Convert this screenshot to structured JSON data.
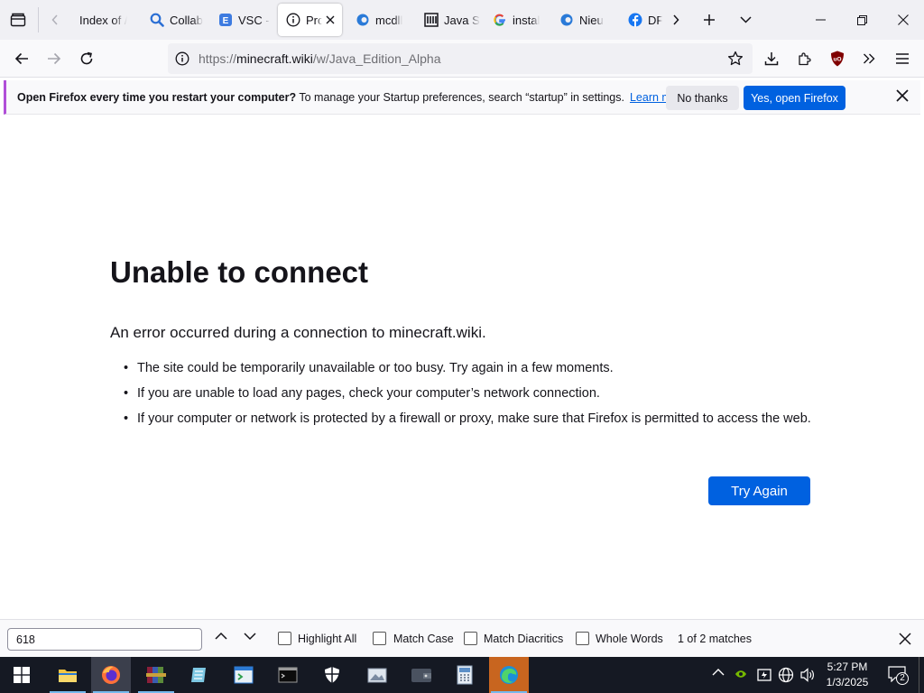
{
  "tabs": [
    {
      "title": "Index of /",
      "icon": "none"
    },
    {
      "title": "Collab",
      "icon": "magnifier-icon"
    },
    {
      "title": "VSC -",
      "icon": "e-icon"
    },
    {
      "title": "Pro",
      "icon": "info-icon",
      "active": true
    },
    {
      "title": "mcdll",
      "icon": "edge-icon"
    },
    {
      "title": "Java S",
      "icon": "library-icon"
    },
    {
      "title": "instal",
      "icon": "google-icon"
    },
    {
      "title": "Nieu",
      "icon": "edge-icon"
    },
    {
      "title": "DF",
      "icon": "facebook-icon"
    }
  ],
  "url": {
    "prefix": "https://",
    "host": "minecraft.wiki",
    "path": "/w/Java_Edition_Alpha"
  },
  "notification": {
    "bold": "Open Firefox every time you restart your computer?",
    "text": "To manage your Startup preferences, search “startup” in settings.",
    "link": "Learn more",
    "no_thanks": "No thanks",
    "yes": "Yes, open Firefox"
  },
  "error": {
    "title": "Unable to connect",
    "description": "An error occurred during a connection to minecraft.wiki.",
    "bullets": [
      "The site could be temporarily unavailable or too busy. Try again in a few moments.",
      "If you are unable to load any pages, check your computer’s network connection.",
      "If your computer or network is protected by a firewall or proxy, make sure that Firefox is permitted to access the web."
    ],
    "try_again": "Try Again"
  },
  "findbar": {
    "query": "618",
    "highlight_all": "Highlight All",
    "match_case": "Match Case",
    "match_diacritics": "Match Diacritics",
    "whole_words": "Whole Words",
    "status": "1 of 2 matches"
  },
  "taskbar": {
    "time": "5:27 PM",
    "date": "1/3/2025",
    "notification_count": "2"
  },
  "colors": {
    "accent": "#0061e0",
    "notif_border": "#b150d8",
    "taskbar": "#151923"
  }
}
